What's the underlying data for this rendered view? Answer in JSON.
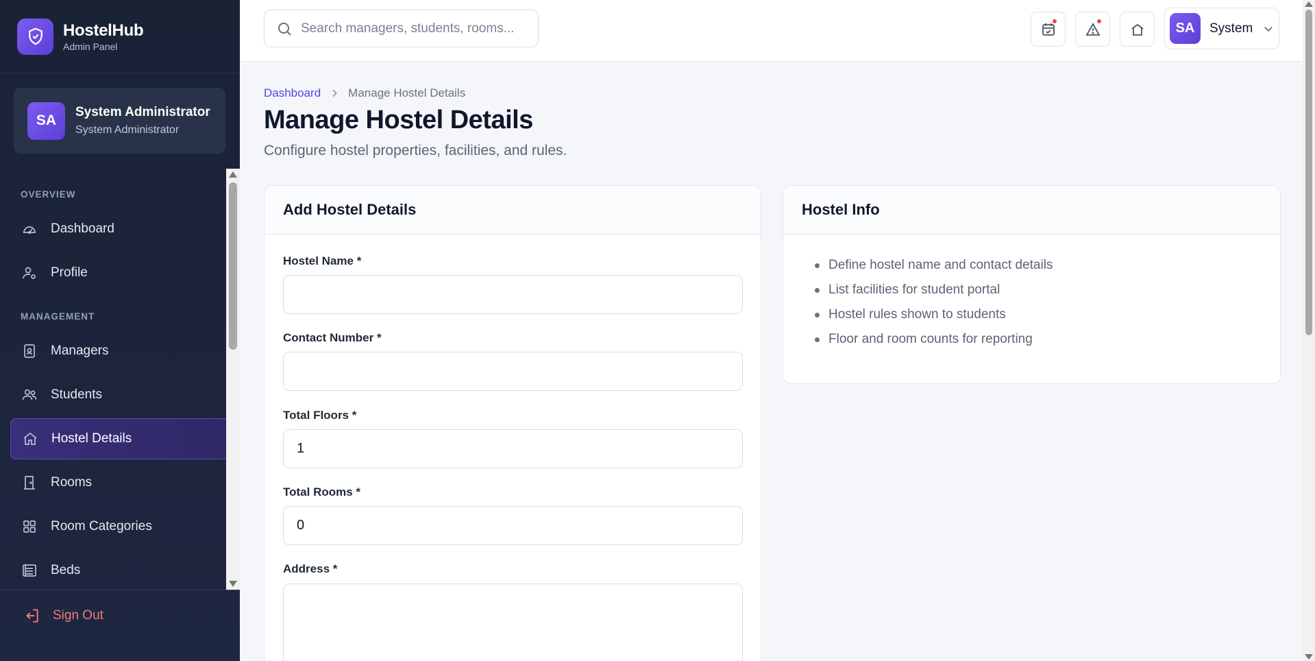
{
  "brand": {
    "title": "HostelHub",
    "subtitle": "Admin Panel"
  },
  "user": {
    "initials": "SA",
    "name": "System Administrator",
    "role": "System Administrator"
  },
  "sidebar": {
    "sections": [
      {
        "label": "OVERVIEW"
      },
      {
        "label": "MANAGEMENT"
      }
    ],
    "items": [
      {
        "label": "Dashboard",
        "icon": "gauge-icon"
      },
      {
        "label": "Profile",
        "icon": "user-gear-icon"
      },
      {
        "label": "Managers",
        "icon": "id-badge-icon"
      },
      {
        "label": "Students",
        "icon": "users-icon"
      },
      {
        "label": "Hostel Details",
        "icon": "home-icon",
        "active": true
      },
      {
        "label": "Rooms",
        "icon": "door-icon"
      },
      {
        "label": "Room Categories",
        "icon": "grid-icon"
      },
      {
        "label": "Beds",
        "icon": "bed-list-icon"
      }
    ],
    "signout": "Sign Out"
  },
  "topbar": {
    "search_placeholder": "Search managers, students, rooms...",
    "profile_initials": "SA",
    "profile_name": "System"
  },
  "breadcrumb": {
    "root": "Dashboard",
    "current": "Manage Hostel Details"
  },
  "page": {
    "title": "Manage Hostel Details",
    "subtitle": "Configure hostel properties, facilities, and rules."
  },
  "form": {
    "heading": "Add Hostel Details",
    "fields": [
      {
        "label": "Hostel Name *",
        "value": ""
      },
      {
        "label": "Contact Number *",
        "value": ""
      },
      {
        "label": "Total Floors *",
        "value": "1"
      },
      {
        "label": "Total Rooms *",
        "value": "0"
      },
      {
        "label": "Address *",
        "value": ""
      }
    ]
  },
  "info": {
    "heading": "Hostel Info",
    "items": [
      "Define hostel name and contact details",
      "List facilities for student portal",
      "Hostel rules shown to students",
      "Floor and room counts for reporting"
    ]
  },
  "colors": {
    "accent": "#6d4fe6",
    "sidebar_bg": "#1e2740",
    "danger": "#f47a7a",
    "link": "#4f46e5"
  }
}
